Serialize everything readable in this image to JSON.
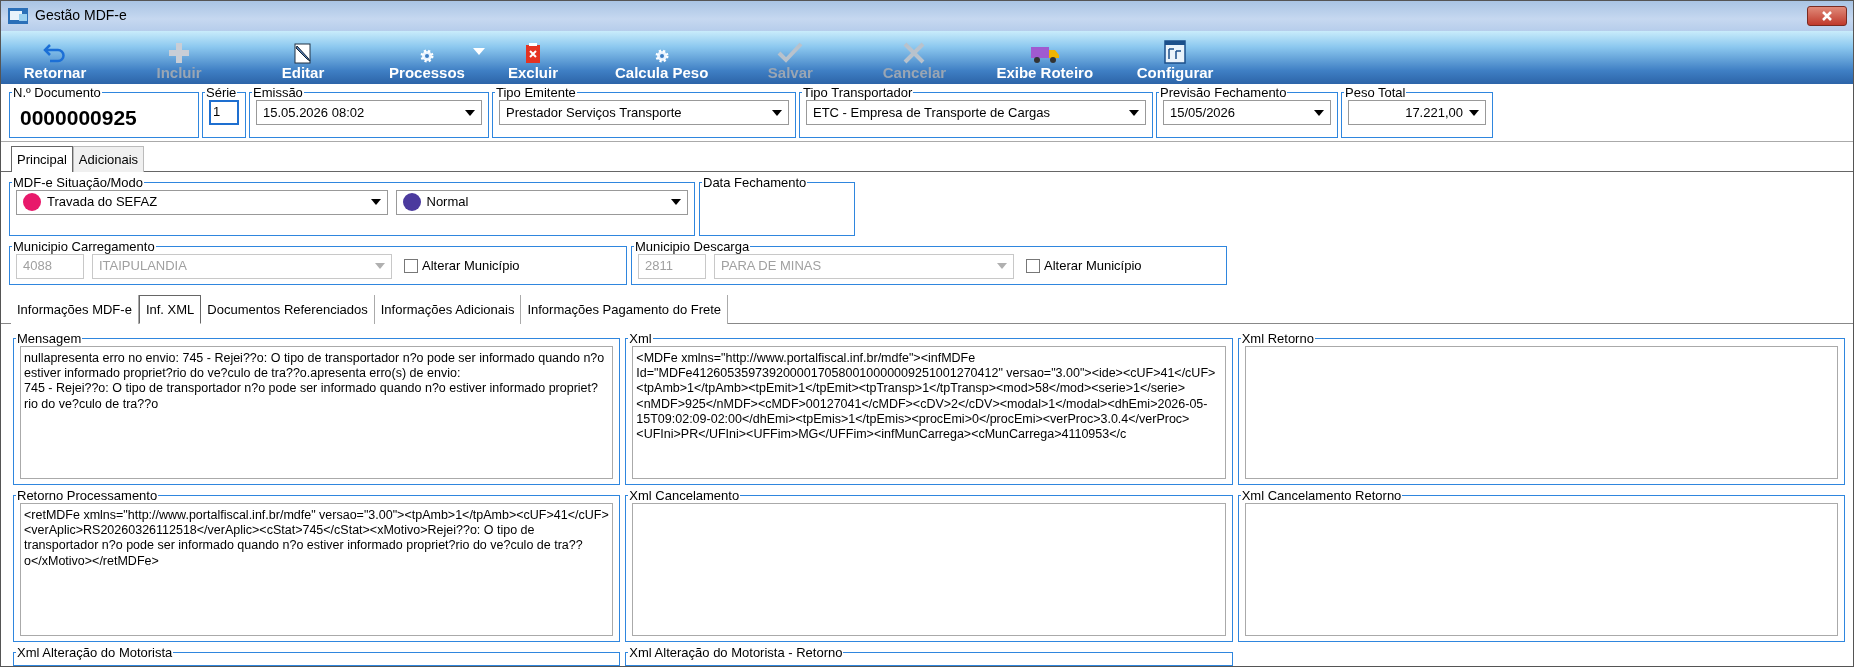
{
  "window": {
    "title": "Gestão MDF-e"
  },
  "toolbar": [
    {
      "label": "Retornar",
      "disabled": false,
      "dropdown": false
    },
    {
      "label": "Incluir",
      "disabled": true,
      "dropdown": false
    },
    {
      "label": "Editar",
      "disabled": false,
      "dropdown": false
    },
    {
      "label": "Processos",
      "disabled": false,
      "dropdown": true
    },
    {
      "label": "Excluir",
      "disabled": false,
      "dropdown": false
    },
    {
      "label": "Calcula Peso",
      "disabled": false,
      "dropdown": false
    },
    {
      "label": "Salvar",
      "disabled": true,
      "dropdown": false
    },
    {
      "label": "Cancelar",
      "disabled": true,
      "dropdown": false
    },
    {
      "label": "Exibe Roteiro",
      "disabled": false,
      "dropdown": false
    },
    {
      "label": "Configurar",
      "disabled": false,
      "dropdown": false
    }
  ],
  "header_fields": [
    {
      "kind": "number",
      "label": "N.º Documento",
      "value": "0000000925"
    },
    {
      "kind": "input",
      "label": "Série",
      "value": "1"
    },
    {
      "kind": "select",
      "label": "Emissão",
      "value": "15.05.2026 08:02"
    },
    {
      "kind": "select",
      "label": "Tipo Emitente",
      "value": "Prestador Serviços Transporte"
    },
    {
      "kind": "select",
      "label": "Tipo Transportador",
      "value": "ETC - Empresa de Transporte de Cargas"
    },
    {
      "kind": "select",
      "label": "Previsão Fechamento",
      "value": "15/05/2026"
    },
    {
      "kind": "amount",
      "label": "Peso Total",
      "value": "17.221,00"
    }
  ],
  "main_tabs": [
    {
      "label": "Principal",
      "selected": true
    },
    {
      "label": "Adicionais",
      "selected": false
    }
  ],
  "situacao": {
    "label": "MDF-e Situação/Modo",
    "selects": [
      {
        "value": "Travada do SEFAZ",
        "color": "#e8196b"
      },
      {
        "value": "Normal",
        "color": "#4b3a9e"
      }
    ]
  },
  "data_fechamento": {
    "label": "Data Fechamento"
  },
  "municipios": [
    {
      "label": "Municipio Carregamento",
      "code": "4088",
      "name": "ITAIPULANDIA",
      "disabled": true,
      "checkbox": {
        "label": "Alterar Município",
        "checked": false
      }
    },
    {
      "label": "Municipio Descarga",
      "code": "2811",
      "name": "PARA DE MINAS",
      "disabled": true,
      "checkbox": {
        "label": "Alterar Município",
        "checked": false
      }
    }
  ],
  "sub_tabs": [
    {
      "label": "Informações MDF-e",
      "selected": false
    },
    {
      "label": "Inf. XML",
      "selected": true
    },
    {
      "label": "Documentos Referenciados",
      "selected": false
    },
    {
      "label": "Informações Adicionais",
      "selected": false
    },
    {
      "label": "Informações Pagamento do Frete",
      "selected": false
    }
  ],
  "panels": [
    {
      "title": "Mensagem",
      "text": "nullapresenta erro no envio: 745 - Rejei??o: O tipo de transportador n?o pode ser informado quando n?o estiver informado propriet?rio do ve?culo de tra??o.apresenta erro(s) de envio:\n745 - Rejei??o: O tipo de transportador n?o pode ser informado quando n?o estiver informado propriet?rio do ve?culo de tra??o"
    },
    {
      "title": "Xml",
      "text": "<MDFe xmlns=\"http://www.portalfiscal.inf.br/mdfe\"><infMDFe Id=\"MDFe41260535973920000170580010000009251001270412\" versao=\"3.00\"><ide><cUF>41</cUF><tpAmb>1</tpAmb><tpEmit>1</tpEmit><tpTransp>1</tpTransp><mod>58</mod><serie>1</serie><nMDF>925</nMDF><cMDF>00127041</cMDF><cDV>2</cDV><modal>1</modal><dhEmi>2026-05-15T09:02:09-02:00</dhEmi><tpEmis>1</tpEmis><procEmi>0</procEmi><verProc>3.0.4</verProc><UFIni>PR</UFIni><UFFim>MG</UFFim><infMunCarrega><cMunCarrega>4110953</c"
    },
    {
      "title": "Xml Retorno"
    },
    {
      "title": "Retorno Processamento",
      "text": "<retMDFe xmlns=\"http://www.portalfiscal.inf.br/mdfe\" versao=\"3.00\"><tpAmb>1</tpAmb><cUF>41</cUF><verAplic>RS20260326112518</verAplic><cStat>745</cStat><xMotivo>Rejei??o: O tipo de transportador n?o pode ser informado quando n?o estiver informado propriet?rio do ve?culo de tra??o</xMotivo></retMDFe>"
    },
    {
      "title": "Xml Cancelamento"
    },
    {
      "title": "Xml Cancelamento Retorno"
    },
    {
      "title": "Xml Alteração do Motorista"
    },
    {
      "title": "Xml Alteração do Motorista - Retorno"
    }
  ]
}
